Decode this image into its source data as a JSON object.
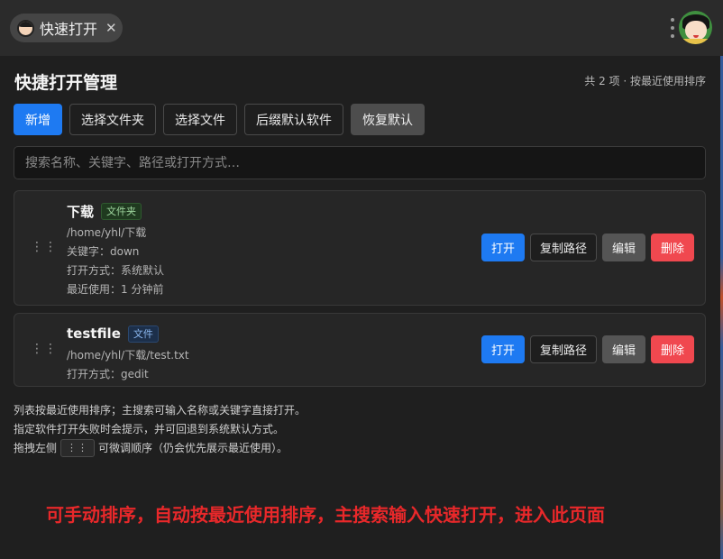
{
  "tab": {
    "label": "快速打开",
    "close": "✕"
  },
  "header": {
    "title": "快捷打开管理",
    "count_hint": "共 2 项 · 按最近使用排序"
  },
  "toolbar": {
    "add": "新增",
    "pick_folder": "选择文件夹",
    "pick_file": "选择文件",
    "suffix_default_app": "后缀默认软件",
    "restore_default": "恢复默认"
  },
  "search": {
    "placeholder": "搜索名称、关键字、路径或打开方式…",
    "value": ""
  },
  "items": [
    {
      "name": "下载",
      "tag": "文件夹",
      "path": "/home/yhl/下载",
      "keyword": "关键字：down",
      "open_with": "打开方式：系统默认",
      "last_used": "最近使用：1 分钟前"
    },
    {
      "name": "testfile",
      "tag": "文件",
      "path": "/home/yhl/下载/test.txt",
      "open_with": "打开方式：gedit"
    }
  ],
  "actions": {
    "open": "打开",
    "copy_path": "复制路径",
    "edit": "编辑",
    "delete": "删除"
  },
  "drag_glyph": "⋮⋮",
  "help": {
    "line1": "列表按最近使用排序；主搜索可输入名称或关键字直接打开。",
    "line2": "指定软件打开失败时会提示，并可回退到系统默认方式。",
    "line3_prefix": "拖拽左侧",
    "line3_kbd": "⋮⋮",
    "line3_suffix": "可微调顺序（仍会优先展示最近使用）。"
  },
  "annotation": "可手动排序，自动按最近使用排序，主搜索输入快速打开，进入此页面",
  "colors": {
    "primary": "#1e7af2",
    "danger": "#f0484f",
    "annotation": "#e8282a"
  }
}
